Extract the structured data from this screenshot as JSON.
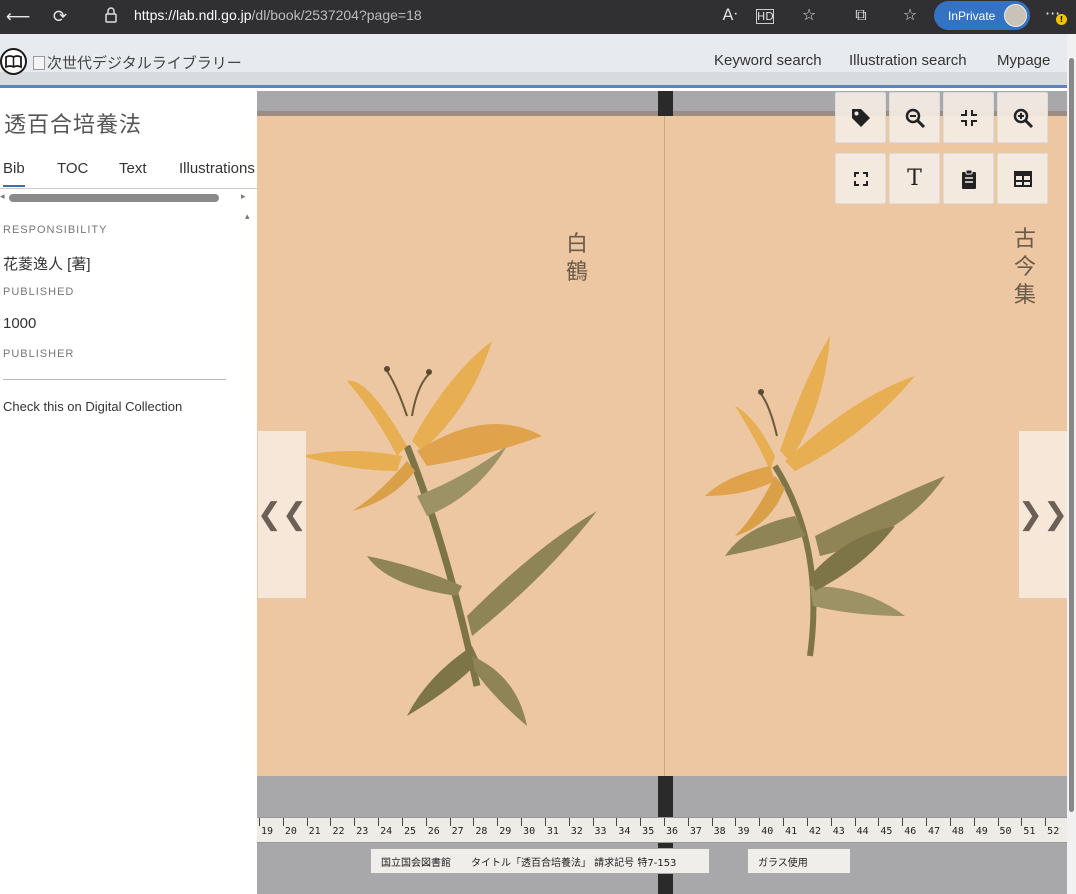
{
  "browser": {
    "url_host": "https://lab.ndl.go.jp",
    "url_path": "/dl/book/2537204?page=18",
    "inprivate_label": "InPrivate",
    "notification_badge": "!"
  },
  "header": {
    "logo_alt": "次世代デジタルライブラリー",
    "nav": [
      "Keyword search",
      "Illustration search",
      "Mypage"
    ]
  },
  "sidebar": {
    "title": "透百合培養法",
    "tabs": [
      "Bib",
      "TOC",
      "Text",
      "Illustrations"
    ],
    "active_tab": "Bib",
    "fields": [
      {
        "label": "RESPONSIBILITY",
        "value": "花菱逸人 [著]"
      },
      {
        "label": "PUBLISHED",
        "value": "1000"
      },
      {
        "label": "PUBLISHER",
        "value": ""
      }
    ],
    "check_link": "Check this on Digital Collection"
  },
  "viewer": {
    "left_caption": "白鶴",
    "right_caption": "古今集",
    "ruler_numbers": [
      "19",
      "20",
      "21",
      "22",
      "23",
      "24",
      "25",
      "26",
      "27",
      "28",
      "29",
      "30",
      "31",
      "32",
      "33",
      "34",
      "35",
      "36",
      "37",
      "38",
      "39",
      "40",
      "41",
      "42",
      "43",
      "44",
      "45",
      "46",
      "47",
      "48",
      "49",
      "50",
      "51",
      "52"
    ],
    "label_strip_left": "国立国会図書館　　タイトル「透百合培養法」 請求記号 特7-153",
    "label_strip_right": "ガラス使用",
    "prev_arrow": "❮❮",
    "next_arrow": "❯❯",
    "tools": [
      "tag-icon",
      "zoom-out-icon",
      "fit-icon",
      "zoom-in-icon",
      "fullscreen-icon",
      "text-icon",
      "clipboard-icon",
      "table-icon"
    ]
  },
  "colors": {
    "accent": "#3b6fb0",
    "page": "#ecc7a2",
    "lily": "#e8ae52",
    "leaf": "#8e8456"
  }
}
